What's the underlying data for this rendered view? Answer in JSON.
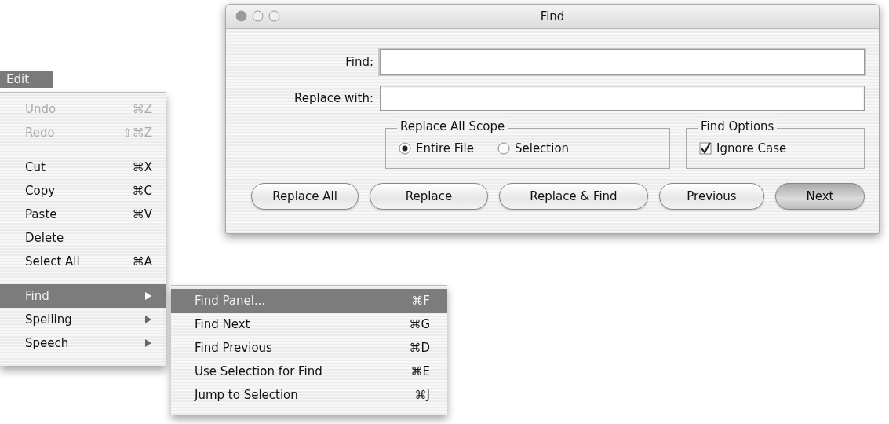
{
  "edit_menu": {
    "title": "Edit",
    "open": true,
    "items": [
      {
        "kind": "item",
        "label": "Undo",
        "shortcut": "⌘Z",
        "disabled": true,
        "selected": false,
        "submenu": false
      },
      {
        "kind": "item",
        "label": "Redo",
        "shortcut": "⇧⌘Z",
        "disabled": true,
        "selected": false,
        "submenu": false
      },
      {
        "kind": "separator"
      },
      {
        "kind": "item",
        "label": "Cut",
        "shortcut": "⌘X",
        "disabled": false,
        "selected": false,
        "submenu": false
      },
      {
        "kind": "item",
        "label": "Copy",
        "shortcut": "⌘C",
        "disabled": false,
        "selected": false,
        "submenu": false
      },
      {
        "kind": "item",
        "label": "Paste",
        "shortcut": "⌘V",
        "disabled": false,
        "selected": false,
        "submenu": false
      },
      {
        "kind": "item",
        "label": "Delete",
        "disabled": false,
        "selected": false,
        "submenu": false
      },
      {
        "kind": "item",
        "label": "Select All",
        "shortcut": "⌘A",
        "disabled": false,
        "selected": false,
        "submenu": false
      },
      {
        "kind": "separator"
      },
      {
        "kind": "item",
        "label": "Find",
        "disabled": false,
        "selected": true,
        "submenu": true
      },
      {
        "kind": "item",
        "label": "Spelling",
        "disabled": false,
        "selected": false,
        "submenu": true
      },
      {
        "kind": "item",
        "label": "Speech",
        "disabled": false,
        "selected": false,
        "submenu": true
      }
    ]
  },
  "find_submenu": {
    "items": [
      {
        "label": "Find Panel...",
        "shortcut": "⌘F",
        "selected": true
      },
      {
        "label": "Find Next",
        "shortcut": "⌘G",
        "selected": false
      },
      {
        "label": "Find Previous",
        "shortcut": "⌘D",
        "selected": false
      },
      {
        "label": "Use Selection for Find",
        "shortcut": "⌘E",
        "selected": false
      },
      {
        "label": "Jump to Selection",
        "shortcut": "⌘J",
        "selected": false
      }
    ]
  },
  "find_window": {
    "title": "Find",
    "fields": [
      {
        "label": "Find:",
        "focused": true
      },
      {
        "label": "Replace with:",
        "focused": false
      }
    ],
    "scope": {
      "title": "Replace All Scope",
      "options": [
        {
          "label": "Entire File",
          "selected": true
        },
        {
          "label": "Selection",
          "selected": false
        }
      ]
    },
    "find_options": {
      "title": "Find Options",
      "checkboxes": [
        {
          "label": "Ignore Case",
          "checked": true
        }
      ]
    },
    "buttons": [
      {
        "label": "Replace All",
        "default": false
      },
      {
        "label": "Replace",
        "default": false
      },
      {
        "label": "Replace & Find",
        "default": false
      },
      {
        "label": "Previous",
        "default": false
      },
      {
        "label": "Next",
        "default": true
      }
    ]
  }
}
